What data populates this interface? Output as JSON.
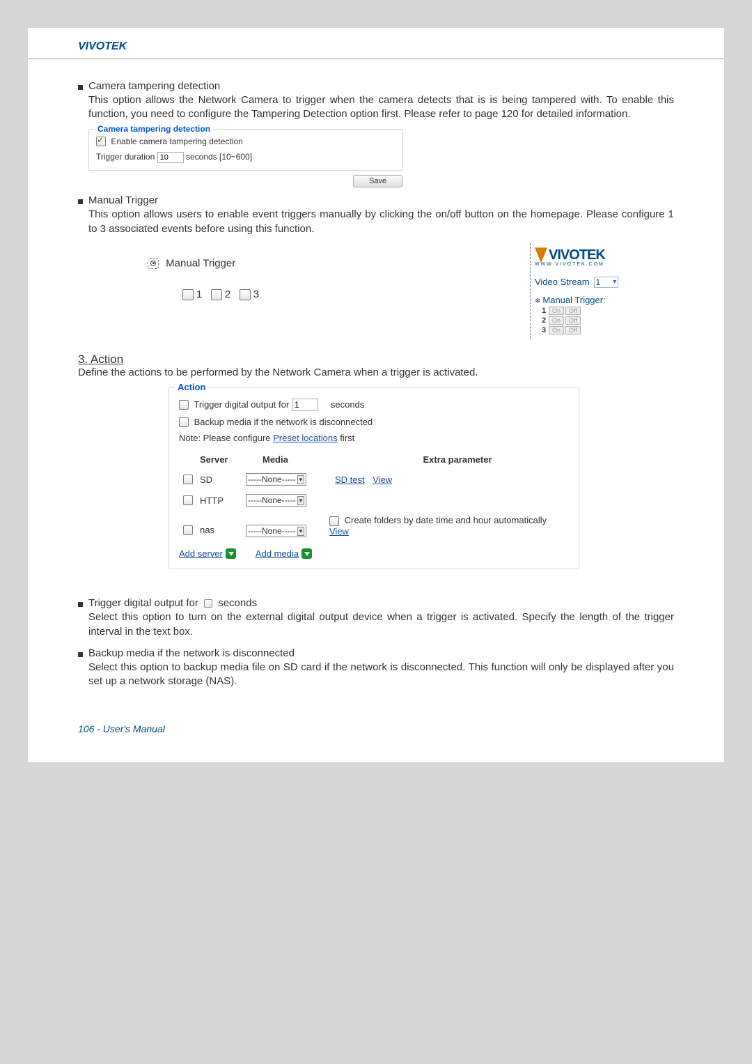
{
  "brand": "VIVOTEK",
  "footer": "106 - User's Manual",
  "b1": {
    "title": "Camera tampering detection",
    "text": "This option allows the Network Camera to trigger when the camera detects that is is being tampered with. To enable this function, you need to configure the Tampering Detection option first. Please refer to page 120 for detailed information."
  },
  "tamper": {
    "legend": "Camera tampering detection",
    "enable": "Enable camera tampering detection",
    "dur_label": "Trigger duration",
    "dur_val": "10",
    "dur_range": "seconds [10~600]",
    "save": "Save"
  },
  "b2": {
    "title": "Manual Trigger",
    "text": "This option allows users to enable event triggers manually by clicking the on/off button on the homepage. Please configure 1 to 3 associated events before using this function."
  },
  "mt": {
    "label": "Manual Trigger",
    "c1": "1",
    "c2": "2",
    "c3": "3",
    "logo": "VIVOTEK",
    "logo_sub": "WWW.VIVOTEK.COM",
    "vs": "Video Stream",
    "vs_val": "1",
    "hdr": "Manual Trigger:",
    "on": "On",
    "off": "Off"
  },
  "s3": {
    "heading": "3. Action",
    "text": "Define the actions to be performed by the Network Camera when a trigger is activated."
  },
  "action": {
    "legend": "Action",
    "digout_a": "Trigger digital output for",
    "digout_val": "1",
    "digout_b": "seconds",
    "backup": "Backup media if the network is disconnected",
    "note_a": "Note: Please configure ",
    "note_link": "Preset locations",
    "note_b": " first",
    "h_server": "Server",
    "h_media": "Media",
    "h_extra": "Extra parameter",
    "none": "-----None-----",
    "sd": "SD",
    "sdtest": "SD test",
    "view": "View",
    "http": "HTTP",
    "nas": "nas",
    "nas_extra": "Create folders by date time and hour automatically",
    "add_server": "Add server",
    "add_media": "Add media"
  },
  "b3": {
    "title_a": "Trigger digital output for ",
    "title_b": " seconds",
    "text": "Select this option to turn on the external digital output device when a trigger is activated. Specify the length of the trigger interval in the text box."
  },
  "b4": {
    "title": "Backup media if the network is disconnected",
    "text": "Select this option to backup media file on SD card if the network is disconnected. This function will only be displayed after you set up a network storage (NAS)."
  }
}
